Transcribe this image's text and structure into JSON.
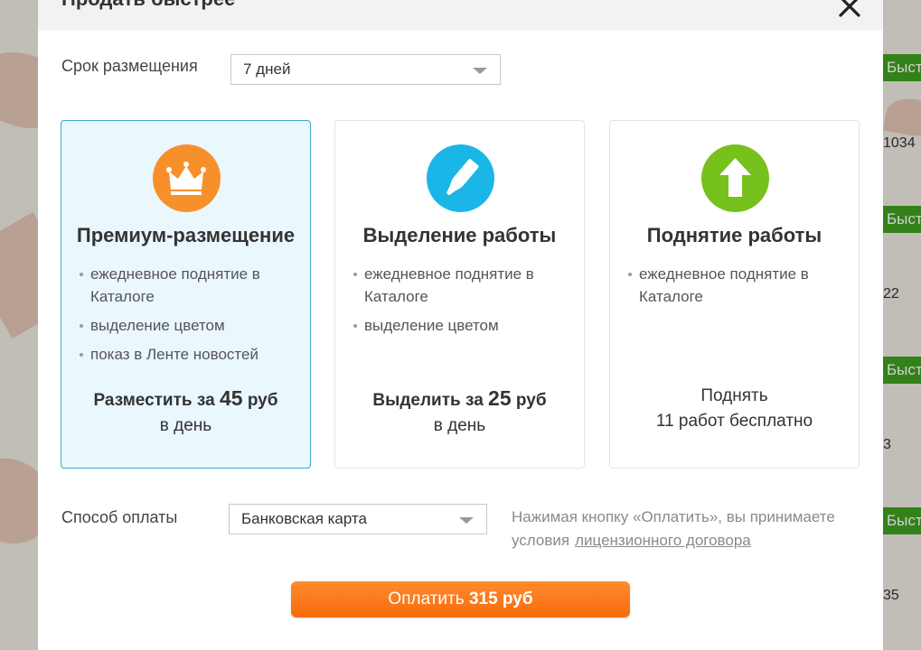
{
  "modal": {
    "title": "Продать быстрее",
    "close_icon": "close-icon"
  },
  "duration": {
    "label": "Срок размещения",
    "selected": "7 дней"
  },
  "cards": [
    {
      "icon": "crown-icon",
      "icon_color": "#f7902b",
      "title": "Премиум-размещение",
      "features": [
        "ежедневное поднятие в Каталоге",
        "выделение цветом",
        "показ в Ленте новостей"
      ],
      "price_prefix": "Разместить за",
      "price_value": "45",
      "price_unit": "руб",
      "price_sub": "в день",
      "selected": true
    },
    {
      "icon": "highlighter-icon",
      "icon_color": "#1ab6e8",
      "title": "Выделение работы",
      "features": [
        "ежедневное поднятие в Каталоге",
        "выделение цветом"
      ],
      "price_prefix": "Выделить за",
      "price_value": "25",
      "price_unit": "руб",
      "price_sub": "в день",
      "selected": false
    },
    {
      "icon": "arrow-up-icon",
      "icon_color": "#77c11c",
      "title": "Поднятие работы",
      "features": [
        "ежедневное поднятие в Каталоге"
      ],
      "free_line1": "Поднять",
      "free_line2": "11 работ бесплатно",
      "selected": false
    }
  ],
  "payment": {
    "label": "Способ оплаты",
    "selected": "Банковская карта",
    "terms_text": "Нажимая кнопку «Оплатить», вы принимаете условия",
    "terms_link": "лицензионного договора"
  },
  "pay_button": {
    "prefix": "Оплатить",
    "amount": "315 руб"
  },
  "background": {
    "badge_text": "Быстрее",
    "numbers": [
      "1034",
      "22",
      "3",
      "35"
    ],
    "badge_color": "#3f9e1f"
  }
}
